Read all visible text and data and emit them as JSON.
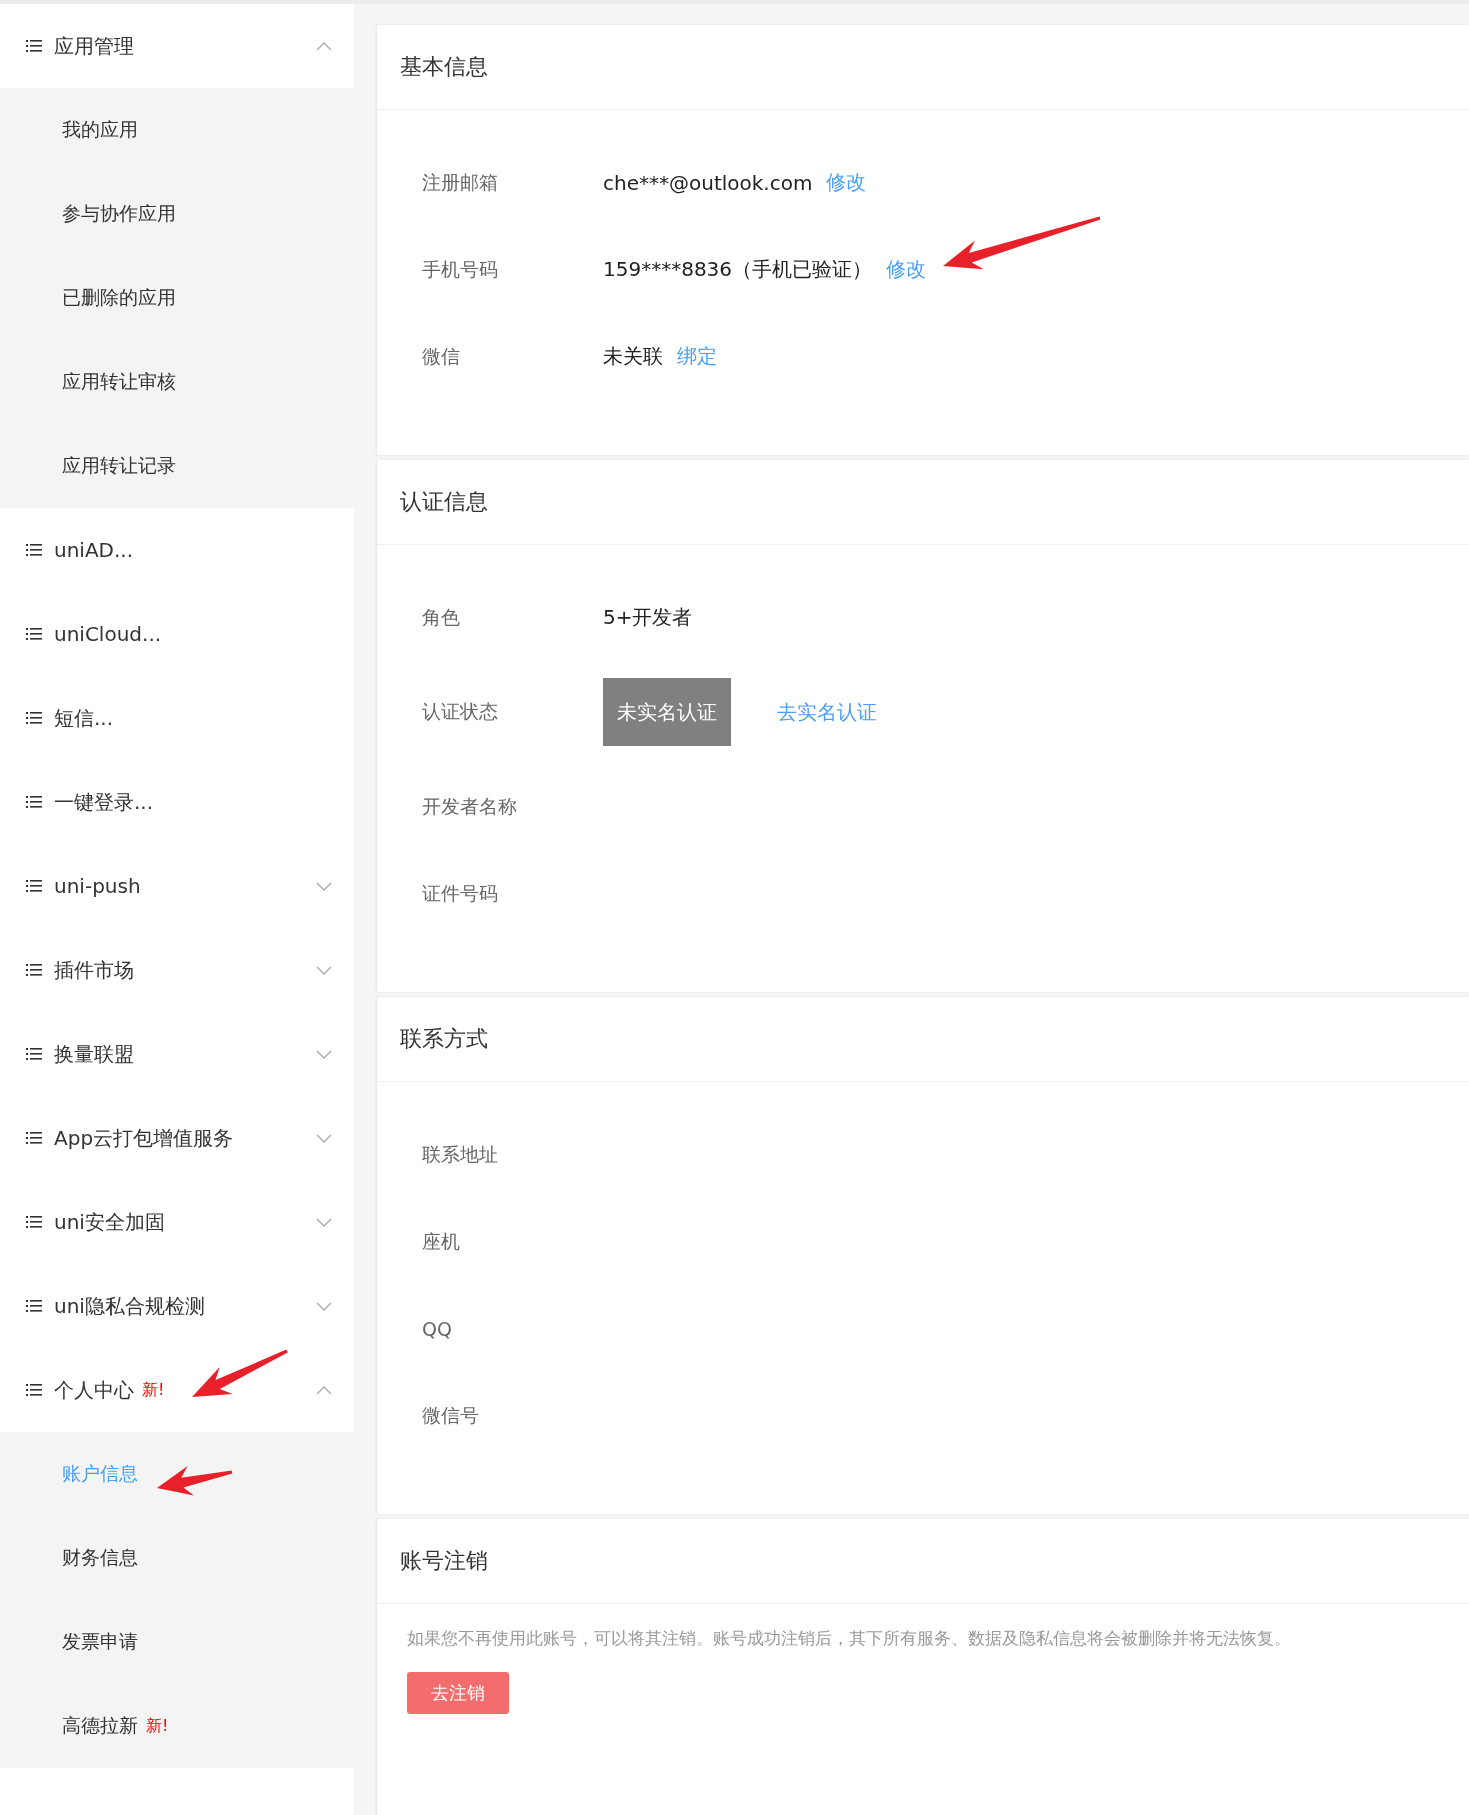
{
  "sidebar": {
    "groups": [
      {
        "label": "应用管理",
        "expanded": true,
        "children": [
          {
            "label": "我的应用",
            "selected": false
          },
          {
            "label": "参与协作应用",
            "selected": false
          },
          {
            "label": "已删除的应用",
            "selected": false
          },
          {
            "label": "应用转让审核",
            "selected": false
          },
          {
            "label": "应用转让记录",
            "selected": false
          }
        ]
      },
      {
        "label": "uniAD..."
      },
      {
        "label": "uniCloud..."
      },
      {
        "label": "短信..."
      },
      {
        "label": "一键登录..."
      },
      {
        "label": "uni-push",
        "expanded": false
      },
      {
        "label": "插件市场",
        "expanded": false
      },
      {
        "label": "换量联盟",
        "expanded": false
      },
      {
        "label": "App云打包增值服务",
        "expanded": false
      },
      {
        "label": "uni安全加固",
        "expanded": false
      },
      {
        "label": "uni隐私合规检测",
        "expanded": false
      },
      {
        "label": "个人中心",
        "badge": "新!",
        "expanded": true,
        "children": [
          {
            "label": "账户信息",
            "selected": true
          },
          {
            "label": "财务信息",
            "selected": false
          },
          {
            "label": "发票申请",
            "selected": false
          },
          {
            "label": "高德拉新",
            "badge": "新!",
            "selected": false
          }
        ]
      }
    ]
  },
  "sections": [
    {
      "title": "基本信息",
      "rows": [
        {
          "label": "注册邮箱",
          "items": [
            {
              "kind": "text",
              "text": "che***@outlook.com"
            },
            {
              "kind": "link",
              "text": "修改"
            }
          ]
        },
        {
          "label": "手机号码",
          "items": [
            {
              "kind": "text",
              "text": "159****8836（手机已验证）"
            },
            {
              "kind": "link",
              "text": "修改"
            }
          ]
        },
        {
          "label": "微信",
          "items": [
            {
              "kind": "text",
              "text": "未关联"
            },
            {
              "kind": "link",
              "text": "绑定"
            }
          ]
        }
      ]
    },
    {
      "title": "认证信息",
      "rows": [
        {
          "label": "角色",
          "items": [
            {
              "kind": "text",
              "text": "5+开发者"
            }
          ]
        },
        {
          "label": "认证状态",
          "items": [
            {
              "kind": "badge",
              "text": "未实名认证"
            },
            {
              "kind": "link",
              "text": "去实名认证"
            }
          ]
        },
        {
          "label": "开发者名称",
          "items": []
        },
        {
          "label": "证件号码",
          "items": []
        }
      ]
    },
    {
      "title": "联系方式",
      "rows": [
        {
          "label": "联系地址",
          "items": []
        },
        {
          "label": "座机",
          "items": []
        },
        {
          "label": "QQ",
          "items": []
        },
        {
          "label": "微信号",
          "items": []
        }
      ]
    },
    {
      "title": "账号注销",
      "notice": "如果您不再使用此账号，可以将其注销。账号成功注销后，其下所有服务、数据及隐私信息将会被删除并将无法恢复。",
      "action": "去注销"
    }
  ]
}
